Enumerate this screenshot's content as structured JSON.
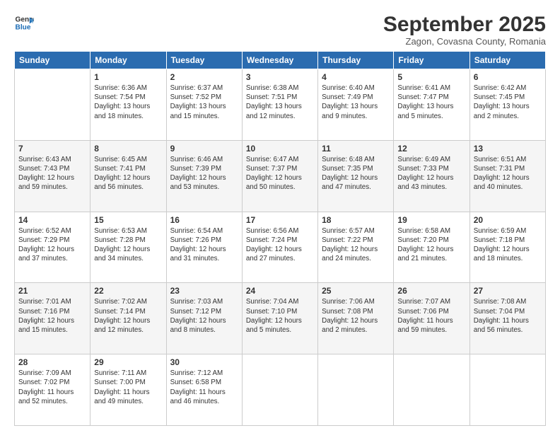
{
  "logo": {
    "line1": "General",
    "line2": "Blue"
  },
  "title": "September 2025",
  "location": "Zagon, Covasna County, Romania",
  "days_of_week": [
    "Sunday",
    "Monday",
    "Tuesday",
    "Wednesday",
    "Thursday",
    "Friday",
    "Saturday"
  ],
  "weeks": [
    [
      {
        "num": "",
        "info": ""
      },
      {
        "num": "1",
        "info": "Sunrise: 6:36 AM\nSunset: 7:54 PM\nDaylight: 13 hours\nand 18 minutes."
      },
      {
        "num": "2",
        "info": "Sunrise: 6:37 AM\nSunset: 7:52 PM\nDaylight: 13 hours\nand 15 minutes."
      },
      {
        "num": "3",
        "info": "Sunrise: 6:38 AM\nSunset: 7:51 PM\nDaylight: 13 hours\nand 12 minutes."
      },
      {
        "num": "4",
        "info": "Sunrise: 6:40 AM\nSunset: 7:49 PM\nDaylight: 13 hours\nand 9 minutes."
      },
      {
        "num": "5",
        "info": "Sunrise: 6:41 AM\nSunset: 7:47 PM\nDaylight: 13 hours\nand 5 minutes."
      },
      {
        "num": "6",
        "info": "Sunrise: 6:42 AM\nSunset: 7:45 PM\nDaylight: 13 hours\nand 2 minutes."
      }
    ],
    [
      {
        "num": "7",
        "info": "Sunrise: 6:43 AM\nSunset: 7:43 PM\nDaylight: 12 hours\nand 59 minutes."
      },
      {
        "num": "8",
        "info": "Sunrise: 6:45 AM\nSunset: 7:41 PM\nDaylight: 12 hours\nand 56 minutes."
      },
      {
        "num": "9",
        "info": "Sunrise: 6:46 AM\nSunset: 7:39 PM\nDaylight: 12 hours\nand 53 minutes."
      },
      {
        "num": "10",
        "info": "Sunrise: 6:47 AM\nSunset: 7:37 PM\nDaylight: 12 hours\nand 50 minutes."
      },
      {
        "num": "11",
        "info": "Sunrise: 6:48 AM\nSunset: 7:35 PM\nDaylight: 12 hours\nand 47 minutes."
      },
      {
        "num": "12",
        "info": "Sunrise: 6:49 AM\nSunset: 7:33 PM\nDaylight: 12 hours\nand 43 minutes."
      },
      {
        "num": "13",
        "info": "Sunrise: 6:51 AM\nSunset: 7:31 PM\nDaylight: 12 hours\nand 40 minutes."
      }
    ],
    [
      {
        "num": "14",
        "info": "Sunrise: 6:52 AM\nSunset: 7:29 PM\nDaylight: 12 hours\nand 37 minutes."
      },
      {
        "num": "15",
        "info": "Sunrise: 6:53 AM\nSunset: 7:28 PM\nDaylight: 12 hours\nand 34 minutes."
      },
      {
        "num": "16",
        "info": "Sunrise: 6:54 AM\nSunset: 7:26 PM\nDaylight: 12 hours\nand 31 minutes."
      },
      {
        "num": "17",
        "info": "Sunrise: 6:56 AM\nSunset: 7:24 PM\nDaylight: 12 hours\nand 27 minutes."
      },
      {
        "num": "18",
        "info": "Sunrise: 6:57 AM\nSunset: 7:22 PM\nDaylight: 12 hours\nand 24 minutes."
      },
      {
        "num": "19",
        "info": "Sunrise: 6:58 AM\nSunset: 7:20 PM\nDaylight: 12 hours\nand 21 minutes."
      },
      {
        "num": "20",
        "info": "Sunrise: 6:59 AM\nSunset: 7:18 PM\nDaylight: 12 hours\nand 18 minutes."
      }
    ],
    [
      {
        "num": "21",
        "info": "Sunrise: 7:01 AM\nSunset: 7:16 PM\nDaylight: 12 hours\nand 15 minutes."
      },
      {
        "num": "22",
        "info": "Sunrise: 7:02 AM\nSunset: 7:14 PM\nDaylight: 12 hours\nand 12 minutes."
      },
      {
        "num": "23",
        "info": "Sunrise: 7:03 AM\nSunset: 7:12 PM\nDaylight: 12 hours\nand 8 minutes."
      },
      {
        "num": "24",
        "info": "Sunrise: 7:04 AM\nSunset: 7:10 PM\nDaylight: 12 hours\nand 5 minutes."
      },
      {
        "num": "25",
        "info": "Sunrise: 7:06 AM\nSunset: 7:08 PM\nDaylight: 12 hours\nand 2 minutes."
      },
      {
        "num": "26",
        "info": "Sunrise: 7:07 AM\nSunset: 7:06 PM\nDaylight: 11 hours\nand 59 minutes."
      },
      {
        "num": "27",
        "info": "Sunrise: 7:08 AM\nSunset: 7:04 PM\nDaylight: 11 hours\nand 56 minutes."
      }
    ],
    [
      {
        "num": "28",
        "info": "Sunrise: 7:09 AM\nSunset: 7:02 PM\nDaylight: 11 hours\nand 52 minutes."
      },
      {
        "num": "29",
        "info": "Sunrise: 7:11 AM\nSunset: 7:00 PM\nDaylight: 11 hours\nand 49 minutes."
      },
      {
        "num": "30",
        "info": "Sunrise: 7:12 AM\nSunset: 6:58 PM\nDaylight: 11 hours\nand 46 minutes."
      },
      {
        "num": "",
        "info": ""
      },
      {
        "num": "",
        "info": ""
      },
      {
        "num": "",
        "info": ""
      },
      {
        "num": "",
        "info": ""
      }
    ]
  ]
}
